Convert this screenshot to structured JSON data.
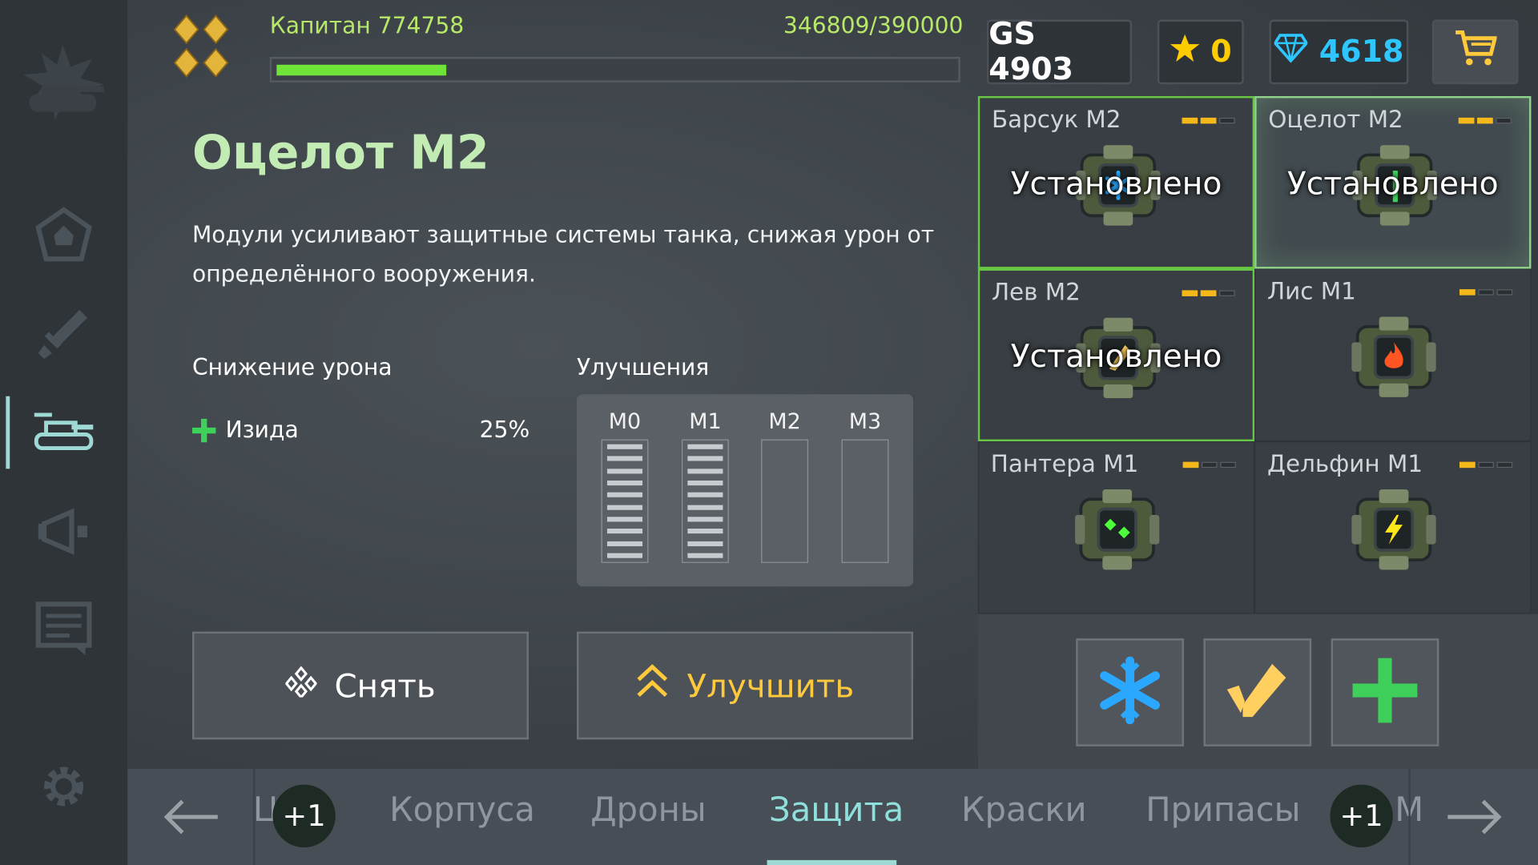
{
  "header": {
    "player_name": "Капитан 774758",
    "xp_text": "346809/390000",
    "xp_fraction": 0.25,
    "gear_score": "GS 4903",
    "stars": "0",
    "crystals": "4618"
  },
  "detail": {
    "title": "Оцелот М2",
    "description": "Модули усиливают защитные системы танка, снижая урон от определённого вооружения.",
    "damage_reduction_heading": "Снижение урона",
    "damage_reduction": [
      {
        "name": "Изида",
        "value": "25%"
      }
    ],
    "upgrades_heading": "Улучшения",
    "upgrade_levels": [
      {
        "label": "М0",
        "filled": true
      },
      {
        "label": "М1",
        "filled": true
      },
      {
        "label": "М2",
        "filled": false
      },
      {
        "label": "М3",
        "filled": false
      }
    ],
    "remove_button": "Снять",
    "upgrade_button": "Улучшить"
  },
  "modules": [
    {
      "name": "Барсук М2",
      "level": 2,
      "status": "Установлено",
      "icon": "freeze-icon",
      "color": "#2aa8ff"
    },
    {
      "name": "Оцелот М2",
      "level": 2,
      "status": "Установлено",
      "icon": "isida-icon",
      "color": "#3ed05a"
    },
    {
      "name": "Лев М2",
      "level": 2,
      "status": "Установлено",
      "icon": "smoky-icon",
      "color": "#ffd060"
    },
    {
      "name": "Лис М1",
      "level": 1,
      "status": "",
      "icon": "fire-icon",
      "color": "#ff5522"
    },
    {
      "name": "Пантера М1",
      "level": 1,
      "status": "",
      "icon": "twins-icon",
      "color": "#4cff3a"
    },
    {
      "name": "Дельфин М1",
      "level": 1,
      "status": "",
      "icon": "lightning-icon",
      "color": "#ffe81a"
    }
  ],
  "installed_slots": [
    "freeze-icon",
    "smoky-icon",
    "isida-icon"
  ],
  "tabs": [
    {
      "label": "Ц",
      "active": false
    },
    {
      "label": "Корпуса",
      "active": false
    },
    {
      "label": "Дроны",
      "active": false
    },
    {
      "label": "Защита",
      "active": true
    },
    {
      "label": "Краски",
      "active": false
    },
    {
      "label": "Припасы",
      "active": false
    },
    {
      "label": "М",
      "active": false
    }
  ],
  "badges": [
    "+1",
    "+1"
  ],
  "colors": {
    "accent": "#9fd9d6",
    "title_green": "#c3ecb4",
    "xp_green": "#6fe338",
    "crystal": "#2ec6ff",
    "star": "#ffcc00",
    "upgrade": "#ffc93c"
  }
}
